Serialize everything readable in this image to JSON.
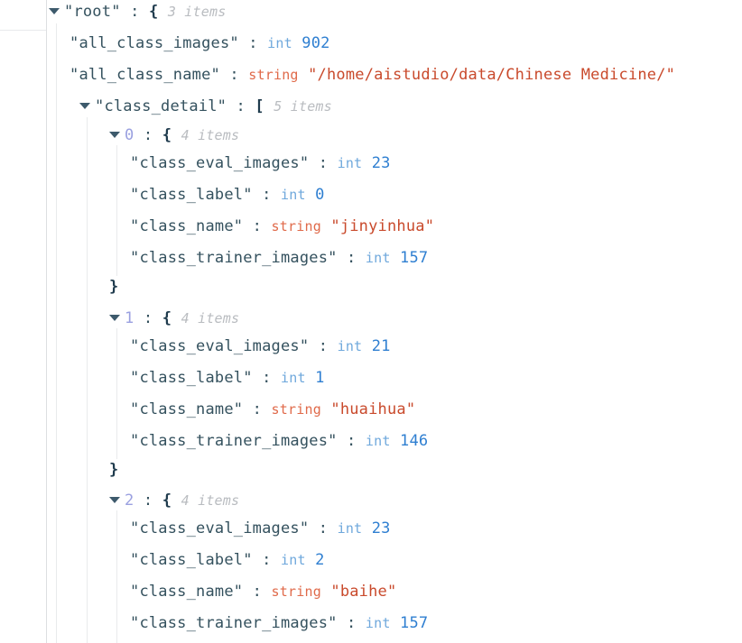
{
  "viewer": {
    "kind": "json-tree-viewer",
    "root_label": "root",
    "colors": {
      "key": "#34515e",
      "index": "#9aa0e0",
      "int_type": "#6fa8dc",
      "int_value": "#2f7fd1",
      "string_type": "#e06a4a",
      "string_value": "#c94a2c",
      "count": "#b9bcc0",
      "triangle": "#3d5a6c"
    },
    "icons": {
      "expanded_triangle": "caret-down-icon"
    }
  },
  "tree": {
    "root": {
      "label": "root",
      "open_brace": "{",
      "close_brace": "}",
      "count": "3 items",
      "colon": ":",
      "quote": "\""
    },
    "rows": [
      {
        "id": "root",
        "kind": "object-open",
        "label": "root",
        "bracket": "{",
        "count": "3 items"
      },
      {
        "id": "all_class_images",
        "kind": "int",
        "label": "all_class_images",
        "type": "int",
        "value": "902"
      },
      {
        "id": "all_class_name",
        "kind": "string",
        "label": "all_class_name",
        "type": "string",
        "value": "/home/aistudio/data/Chinese Medicine/"
      },
      {
        "id": "class_detail",
        "kind": "array-open",
        "label": "class_detail",
        "bracket": "[",
        "count": "5 items"
      },
      {
        "id": "item-0",
        "kind": "index-object-open",
        "index": "0",
        "bracket": "{",
        "count": "4 items"
      },
      {
        "id": "item-0-eval",
        "kind": "int",
        "label": "class_eval_images",
        "type": "int",
        "value": "23"
      },
      {
        "id": "item-0-label",
        "kind": "int",
        "label": "class_label",
        "type": "int",
        "value": "0"
      },
      {
        "id": "item-0-name",
        "kind": "string",
        "label": "class_name",
        "type": "string",
        "value": "jinyinhua"
      },
      {
        "id": "item-0-trainer",
        "kind": "int",
        "label": "class_trainer_images",
        "type": "int",
        "value": "157"
      },
      {
        "id": "item-0-close",
        "kind": "close",
        "bracket": "}"
      },
      {
        "id": "item-1",
        "kind": "index-object-open",
        "index": "1",
        "bracket": "{",
        "count": "4 items"
      },
      {
        "id": "item-1-eval",
        "kind": "int",
        "label": "class_eval_images",
        "type": "int",
        "value": "21"
      },
      {
        "id": "item-1-label",
        "kind": "int",
        "label": "class_label",
        "type": "int",
        "value": "1"
      },
      {
        "id": "item-1-name",
        "kind": "string",
        "label": "class_name",
        "type": "string",
        "value": "huaihua"
      },
      {
        "id": "item-1-trainer",
        "kind": "int",
        "label": "class_trainer_images",
        "type": "int",
        "value": "146"
      },
      {
        "id": "item-1-close",
        "kind": "close",
        "bracket": "}"
      },
      {
        "id": "item-2",
        "kind": "index-object-open",
        "index": "2",
        "bracket": "{",
        "count": "4 items"
      },
      {
        "id": "item-2-eval",
        "kind": "int",
        "label": "class_eval_images",
        "type": "int",
        "value": "23"
      },
      {
        "id": "item-2-label",
        "kind": "int",
        "label": "class_label",
        "type": "int",
        "value": "2"
      },
      {
        "id": "item-2-name",
        "kind": "string",
        "label": "class_name",
        "type": "string",
        "value": "baihe"
      },
      {
        "id": "item-2-trainer",
        "kind": "int",
        "label": "class_trainer_images",
        "type": "int",
        "value": "157"
      }
    ]
  }
}
